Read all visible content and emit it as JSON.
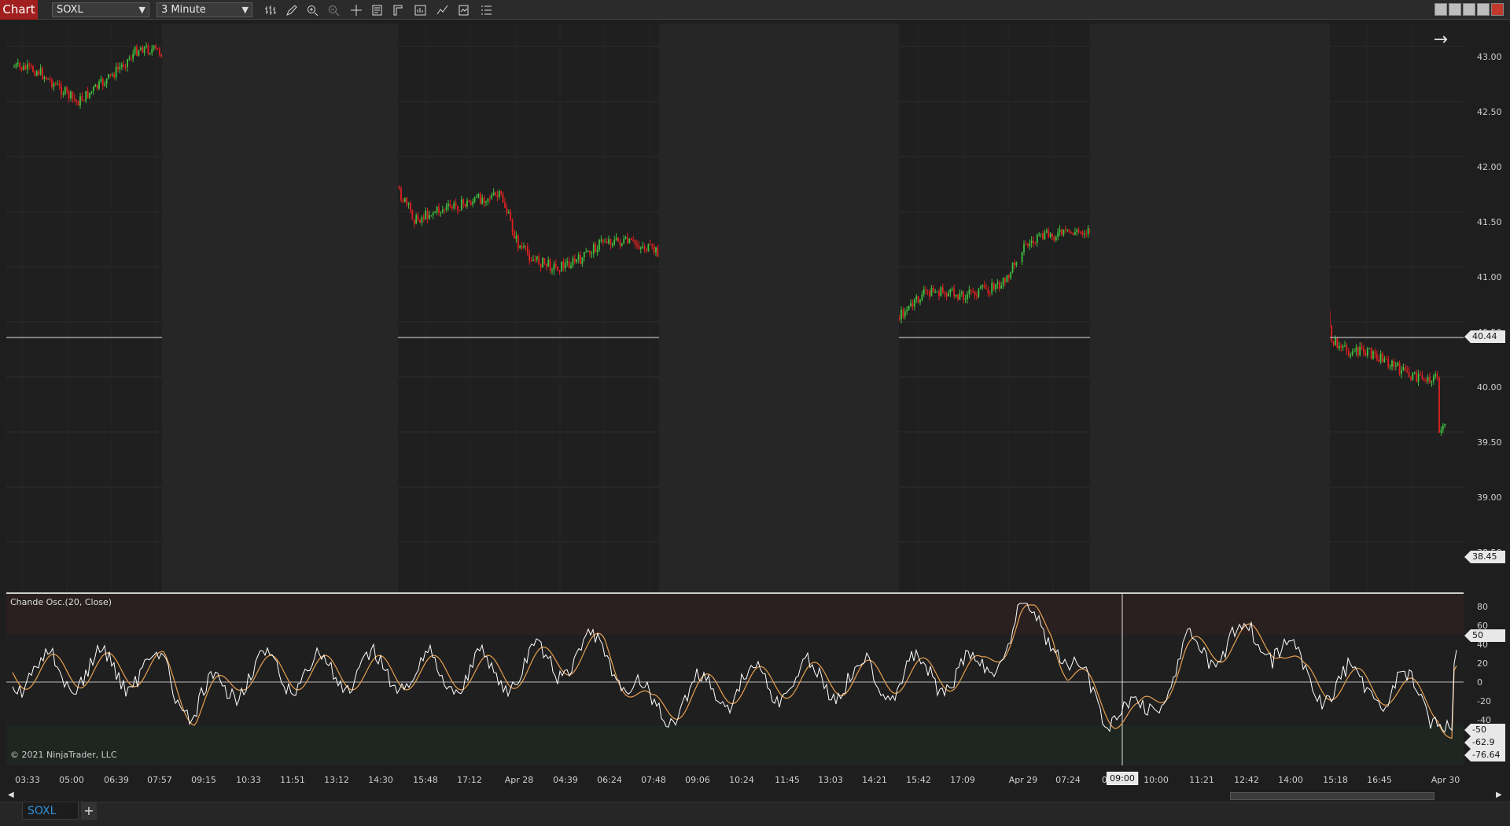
{
  "window": {
    "chart_tab": "Chart",
    "instrument": "SOXL",
    "interval": "3 Minute"
  },
  "toolbar_icons": [
    "bars-type-icon",
    "draw-pencil-icon",
    "zoom-in-icon",
    "zoom-out-icon",
    "crosshair-icon",
    "properties-icon",
    "templates-icon",
    "data-box-icon",
    "strategies-icon",
    "indicators-icon",
    "chart-trader-icon",
    "more-list-icon"
  ],
  "price_axis": {
    "labels": [
      "43.00",
      "42.50",
      "42.00",
      "41.50",
      "41.00",
      "40.50",
      "40.00",
      "39.50",
      "39.00",
      "38.50"
    ],
    "crosshair_price": "40.44",
    "last_price": "38.45"
  },
  "oscillator": {
    "title": "Chande Osc.(20, Close)",
    "labels": [
      "80",
      "60",
      "40",
      "20",
      "0",
      "-20",
      "-40"
    ],
    "tags": [
      "50",
      "-50",
      "-62.9",
      "-76.64"
    ]
  },
  "time_axis": {
    "labels": [
      "03:33",
      "05:00",
      "06:39",
      "07:57",
      "09:15",
      "10:33",
      "11:51",
      "13:12",
      "14:30",
      "15:48",
      "17:12",
      "Apr 28",
      "04:39",
      "06:24",
      "07:48",
      "09:06",
      "10:24",
      "11:45",
      "13:03",
      "14:21",
      "15:42",
      "17:09",
      "Apr 29",
      "07:24",
      "08",
      "10:00",
      "11:21",
      "12:42",
      "14:00",
      "15:18",
      "16:45",
      "Apr 30"
    ],
    "crosshair_time": "09:00"
  },
  "copyright": "© 2021 NinjaTrader, LLC",
  "bottom_tabs": {
    "instrument_tab": "SOXL",
    "add_tab": "+"
  },
  "colors": {
    "up_candle": "#3fbf3f",
    "down_candle": "#e02020",
    "osc_line": "#ffffff",
    "osc_signal": "#e8a050",
    "chart_tab_bg": "#a11f1f",
    "tab_text": "#2e8fd8"
  }
}
